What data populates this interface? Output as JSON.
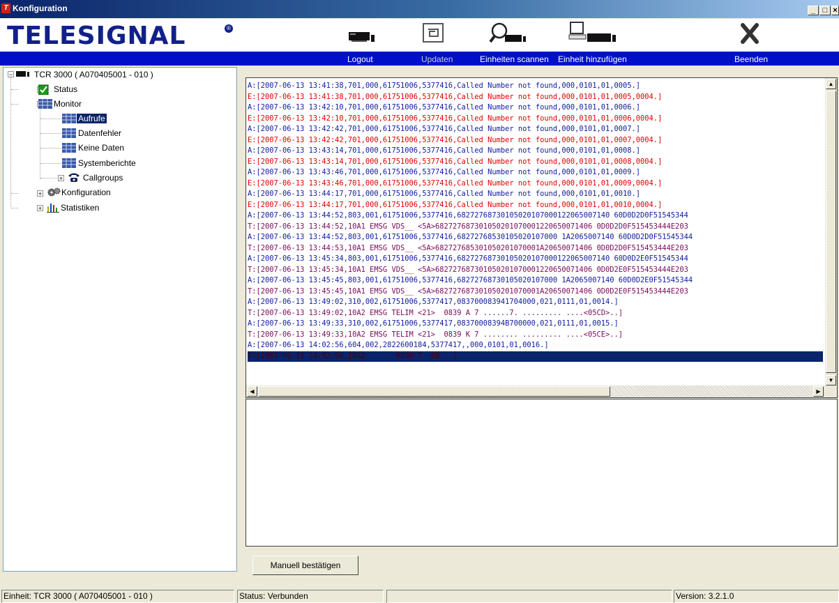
{
  "window": {
    "title": "Konfiguration",
    "app_icon": "telesignal-app-icon",
    "controls": [
      "minimize",
      "maximize",
      "close"
    ]
  },
  "brand": {
    "logo_text": "TELESIGNAL",
    "registered": "®"
  },
  "toolbar": {
    "buttons": [
      {
        "label": "Logout",
        "icon": "logout-device-icon"
      },
      {
        "label": "Updaten",
        "icon": "update-icon"
      },
      {
        "label": "Einheiten scannen",
        "icon": "scan-magnifier-icon"
      },
      {
        "label": "Einheit hinzufügen",
        "icon": "add-unit-computer-icon"
      },
      {
        "label": "Beenden",
        "icon": "exit-x-icon"
      }
    ]
  },
  "tree": {
    "root": "TCR 3000 ( A070405001 - 010 )",
    "items": [
      {
        "label": "Status",
        "icon": "green-check-icon",
        "expander": "+"
      },
      {
        "label": "Monitor",
        "icon": "monitor-grid-icon",
        "expander": "-"
      },
      {
        "label": "Aufrufe",
        "icon": "grid-icon",
        "selected": true
      },
      {
        "label": "Datenfehler",
        "icon": "grid-icon"
      },
      {
        "label": "Keine Daten",
        "icon": "grid-icon"
      },
      {
        "label": "Systemberichte",
        "icon": "grid-icon"
      },
      {
        "label": "Callgroups",
        "icon": "phone-icon",
        "expander": "+"
      },
      {
        "label": "Konfiguration",
        "icon": "gears-icon",
        "expander": "+"
      },
      {
        "label": "Statistiken",
        "icon": "bar-chart-icon",
        "expander": "+"
      }
    ]
  },
  "log": {
    "lines": [
      {
        "c": "blue",
        "t": "A:[2007-06-13 13:41:38,701,000,61751006,5377416,Called Number not found,000,0101,01,0005.]"
      },
      {
        "c": "red",
        "t": "E:[2007-06-13 13:41:38,701,000,61751006,5377416,Called Number not found,000,0101,01,0005,0004.]"
      },
      {
        "c": "blue",
        "t": "A:[2007-06-13 13:42:10,701,000,61751006,5377416,Called Number not found,000,0101,01,0006.]"
      },
      {
        "c": "red",
        "t": "E:[2007-06-13 13:42:10,701,000,61751006,5377416,Called Number not found,000,0101,01,0006,0004.]"
      },
      {
        "c": "blue",
        "t": "A:[2007-06-13 13:42:42,701,000,61751006,5377416,Called Number not found,000,0101,01,0007.]"
      },
      {
        "c": "red",
        "t": "E:[2007-06-13 13:42:42,701,000,61751006,5377416,Called Number not found,000,0101,01,0007,0004.]"
      },
      {
        "c": "blue",
        "t": "A:[2007-06-13 13:43:14,701,000,61751006,5377416,Called Number not found,000,0101,01,0008.]"
      },
      {
        "c": "red",
        "t": "E:[2007-06-13 13:43:14,701,000,61751006,5377416,Called Number not found,000,0101,01,0008,0004.]"
      },
      {
        "c": "blue",
        "t": "A:[2007-06-13 13:43:46,701,000,61751006,5377416,Called Number not found,000,0101,01,0009.]"
      },
      {
        "c": "red",
        "t": "E:[2007-06-13 13:43:46,701,000,61751006,5377416,Called Number not found,000,0101,01,0009,0004.]"
      },
      {
        "c": "blue",
        "t": "A:[2007-06-13 13:44:17,701,000,61751006,5377416,Called Number not found,000,0101,01,0010.]"
      },
      {
        "c": "red",
        "t": "E:[2007-06-13 13:44:17,701,000,61751006,5377416,Called Number not found,000,0101,01,0010,0004.]"
      },
      {
        "c": "blue",
        "t": "A:[2007-06-13 13:44:52,803,001,61751006,5377416,68272768730105020107000122065007140 60D0D2D0F51545344"
      },
      {
        "c": "purple",
        "t": "T:[2007-06-13 13:44:52,10A1 EMSG VDS__ <5A>682727687301050201070001220650071406 0D0D2D0F515453444E203"
      },
      {
        "c": "blue",
        "t": "A:[2007-06-13 13:44:52,803,001,61751006,5377416,68272768530105020107000 1A2065007140 60D0D2D0F51545344"
      },
      {
        "c": "purple",
        "t": "T:[2007-06-13 13:44:53,10A1 EMSG VDS__ <5A>682727685301050201070001A20650071406 0D0D2D0F515453444E203"
      },
      {
        "c": "blue",
        "t": "A:[2007-06-13 13:45:34,803,001,61751006,5377416,68272768730105020107000122065007140 60D0D2E0F51545344"
      },
      {
        "c": "purple",
        "t": "T:[2007-06-13 13:45:34,10A1 EMSG VDS__ <5A>682727687301050201070001220650071406 0D0D2E0F515453444E203"
      },
      {
        "c": "blue",
        "t": "A:[2007-06-13 13:45:45,803,001,61751006,5377416,68272768730105020107000 1A2065007140 60D0D2E0F51545344"
      },
      {
        "c": "purple",
        "t": "T:[2007-06-13 13:45:45,10A1 EMSG VDS__ <5A>682727687301050201070001A20650071406 0D0D2E0F515453444E203"
      },
      {
        "c": "blue",
        "t": "A:[2007-06-13 13:49:02,310,002,61751006,5377417,083700083941704000,021,0111,01,0014.]"
      },
      {
        "c": "purple",
        "t": "T:[2007-06-13 13:49:02,10A2 EMSG TELIM <21>  0839 A 7 ......7. ......... ....<05CD>..]"
      },
      {
        "c": "blue",
        "t": "A:[2007-06-13 13:49:33,310,002,61751006,5377417,08370008394B700000,021,0111,01,0015.]"
      },
      {
        "c": "purple",
        "t": "T:[2007-06-13 13:49:33,10A2 EMSG TELIM <21>  0839 K 7 ........ ......... ....<05CE>..]"
      },
      {
        "c": "blue",
        "t": "A:[2007-06-13 14:02:56,604,002,2822600184,5377417,,000,0101,01,0016.]"
      },
      {
        "c": "hl",
        "t": "T:[2007-06-13 14:02:56,10A2       0000 7  00...]"
      }
    ]
  },
  "confirm_button": "Manuell bestätigen",
  "statusbar": {
    "unit": "Einheit: TCR 3000 ( A070405001 - 010 )",
    "status": "Status: Verbunden",
    "empty": "",
    "version": "Version: 3.2.1.0"
  },
  "colors": {
    "brand_blue": "#12208a",
    "toolbar_band": "#0010c8",
    "error_red": "#e00000",
    "ok_blue": "#101aa0",
    "trace_purple": "#7a0a5a",
    "selection": "#0a246a"
  }
}
